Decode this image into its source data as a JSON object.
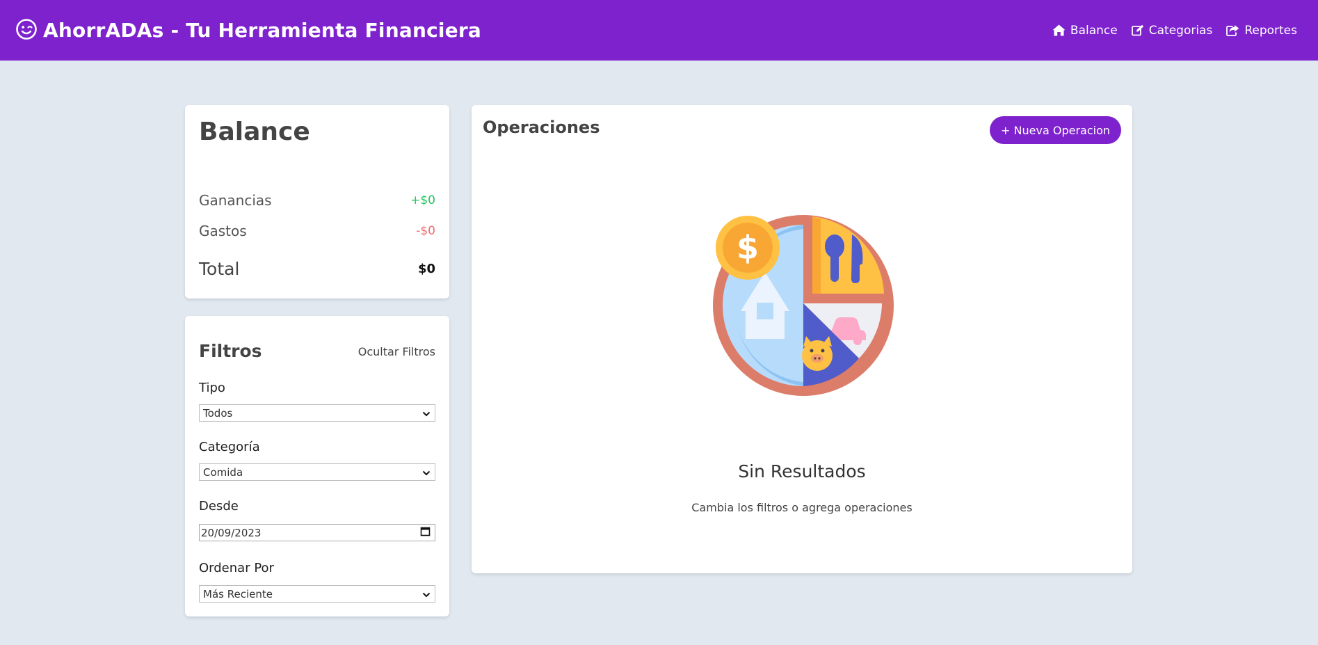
{
  "header": {
    "title": "AhorrADAs - Tu Herramienta Financiera",
    "logo_icon": "smile-wink-icon",
    "background": "#7e22ce",
    "nav": [
      {
        "label": "Balance",
        "icon": "home-icon"
      },
      {
        "label": "Categorias",
        "icon": "edit-icon"
      },
      {
        "label": "Reportes",
        "icon": "share-square-icon"
      }
    ]
  },
  "balance": {
    "title": "Balance",
    "rows": [
      {
        "label": "Ganancias",
        "value": "+$0",
        "color": "#22c55e"
      },
      {
        "label": "Gastos",
        "value": "-$0",
        "color": "#ef6b6b"
      }
    ],
    "total": {
      "label": "Total",
      "value": "$0"
    }
  },
  "filters": {
    "title": "Filtros",
    "toggle_label": "Ocultar Filtros",
    "tipo": {
      "label": "Tipo",
      "value": "Todos"
    },
    "categoria": {
      "label": "Categoría",
      "value": "Comida"
    },
    "desde": {
      "label": "Desde",
      "value": "20/09/2023"
    },
    "orden": {
      "label": "Ordenar Por",
      "value": "Más Reciente"
    }
  },
  "operations": {
    "title": "Operaciones",
    "new_button": "+ Nueva Operacion",
    "empty_title": "Sin Resultados",
    "empty_subtitle": "Cambia los filtros o agrega operaciones",
    "illustration_icon": "budget-pie-icon"
  }
}
